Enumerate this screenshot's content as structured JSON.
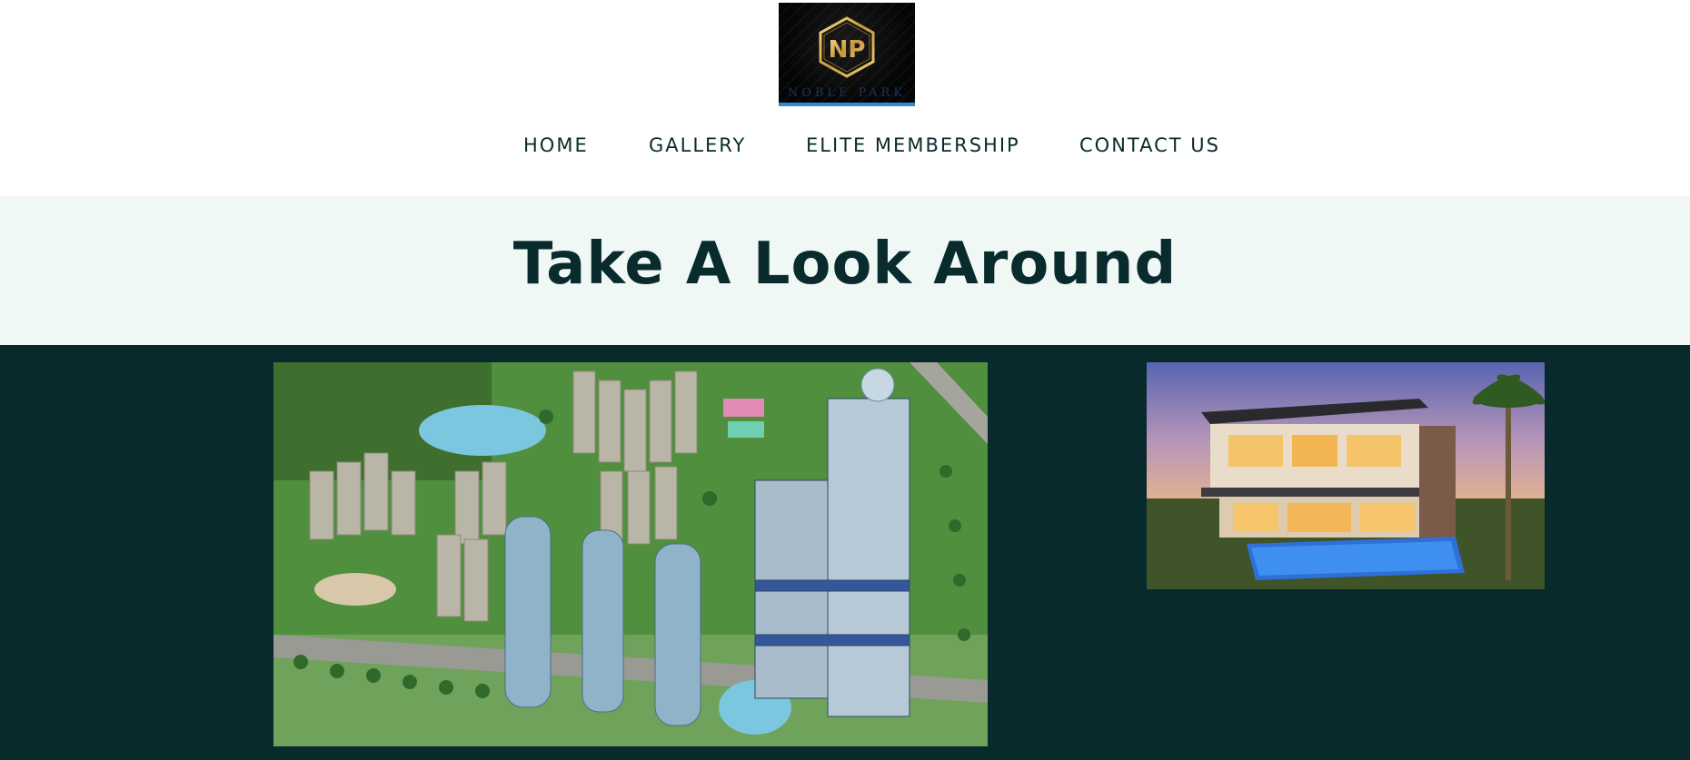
{
  "brand": {
    "monogram": "NP",
    "wordmark": "NOBLE PARK",
    "logo_alt": "Noble Park logo"
  },
  "nav": {
    "items": [
      {
        "label": "HOME"
      },
      {
        "label": "GALLERY"
      },
      {
        "label": "ELITE MEMBERSHIP"
      },
      {
        "label": "CONTACT US"
      }
    ]
  },
  "hero": {
    "title": "Take A Look Around"
  },
  "gallery": {
    "images": [
      {
        "alt": "Aerial view of high-rise residential towers with lake and gardens"
      },
      {
        "alt": "Modern luxury villa with illuminated pool at dusk"
      }
    ]
  },
  "colors": {
    "nav_text": "#0a2b2e",
    "hero_bg": "#eff8f4",
    "gallery_bg": "#082a2c",
    "logo_gold": "#d9b45a",
    "logo_accent": "#2a8fd0"
  }
}
